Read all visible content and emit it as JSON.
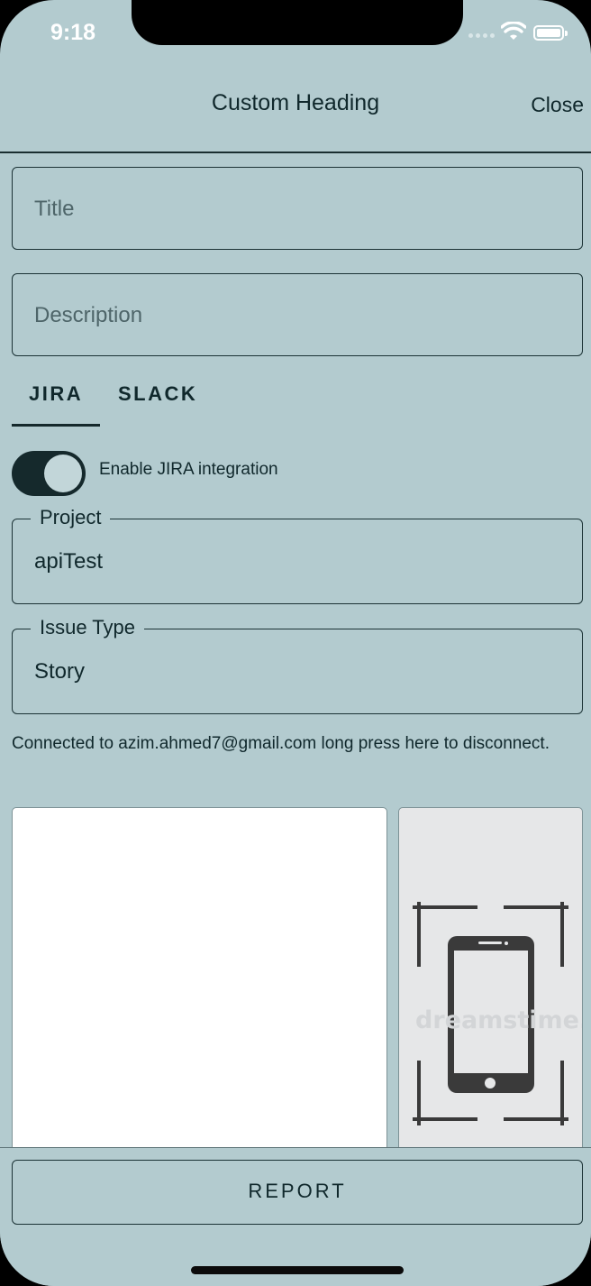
{
  "status_bar": {
    "time": "9:18"
  },
  "header": {
    "title": "Custom Heading",
    "close_label": "Close"
  },
  "form": {
    "title_placeholder": "Title",
    "description_placeholder": "Description"
  },
  "tabs": [
    {
      "label": "JIRA",
      "selected": true
    },
    {
      "label": "SLACK",
      "selected": false
    }
  ],
  "jira": {
    "toggle_label": "Enable JIRA integration",
    "toggle_on": true,
    "project_label": "Project",
    "project_value": "apiTest",
    "issue_type_label": "Issue Type",
    "issue_type_value": "Story",
    "connected_text": "Connected to azim.ahmed7@gmail.com long press here to disconnect."
  },
  "attachment": {
    "watermark": "dreamstime."
  },
  "footer": {
    "report_label": "REPORT"
  },
  "colors": {
    "background": "#b3cbcf",
    "accent": "#15292c"
  }
}
